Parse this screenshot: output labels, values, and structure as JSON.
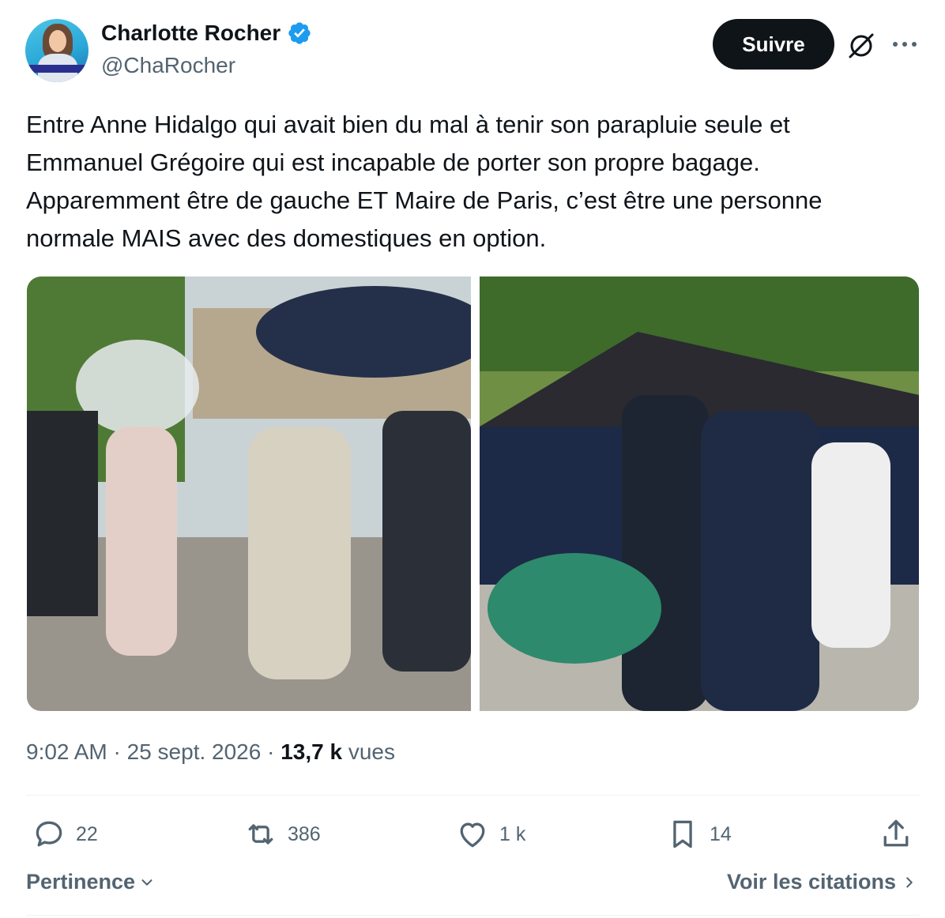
{
  "author": {
    "display_name": "Charlotte Rocher",
    "handle": "@ChaRocher",
    "verified": true,
    "verified_color": "#1d9bf0"
  },
  "header": {
    "follow_label": "Suivre"
  },
  "tweet": {
    "text": "Entre Anne Hidalgo qui avait bien du mal à tenir son parapluie seule et\nEmmanuel Grégoire qui est incapable de porter son propre bagage.\nApparemment être de gauche ET Maire de Paris, c’est être une personne\nnormale MAIS avec des domestiques en option.",
    "time": "9:02 AM",
    "separator": " · ",
    "date": "25 sept. 2026",
    "views_count": "13,7 k",
    "views_label": " vues"
  },
  "media": [
    {
      "icon": "photo"
    },
    {
      "icon": "photo"
    }
  ],
  "actions": {
    "replies": "22",
    "reposts": "386",
    "likes": "1 k",
    "bookmarks": "14"
  },
  "footer": {
    "sort_label": "Pertinence",
    "quotes_label": "Voir les citations"
  },
  "colors": {
    "text": "#0f1419",
    "secondary": "#536471",
    "divider": "#eff3f4",
    "button_bg": "#0f1419"
  }
}
